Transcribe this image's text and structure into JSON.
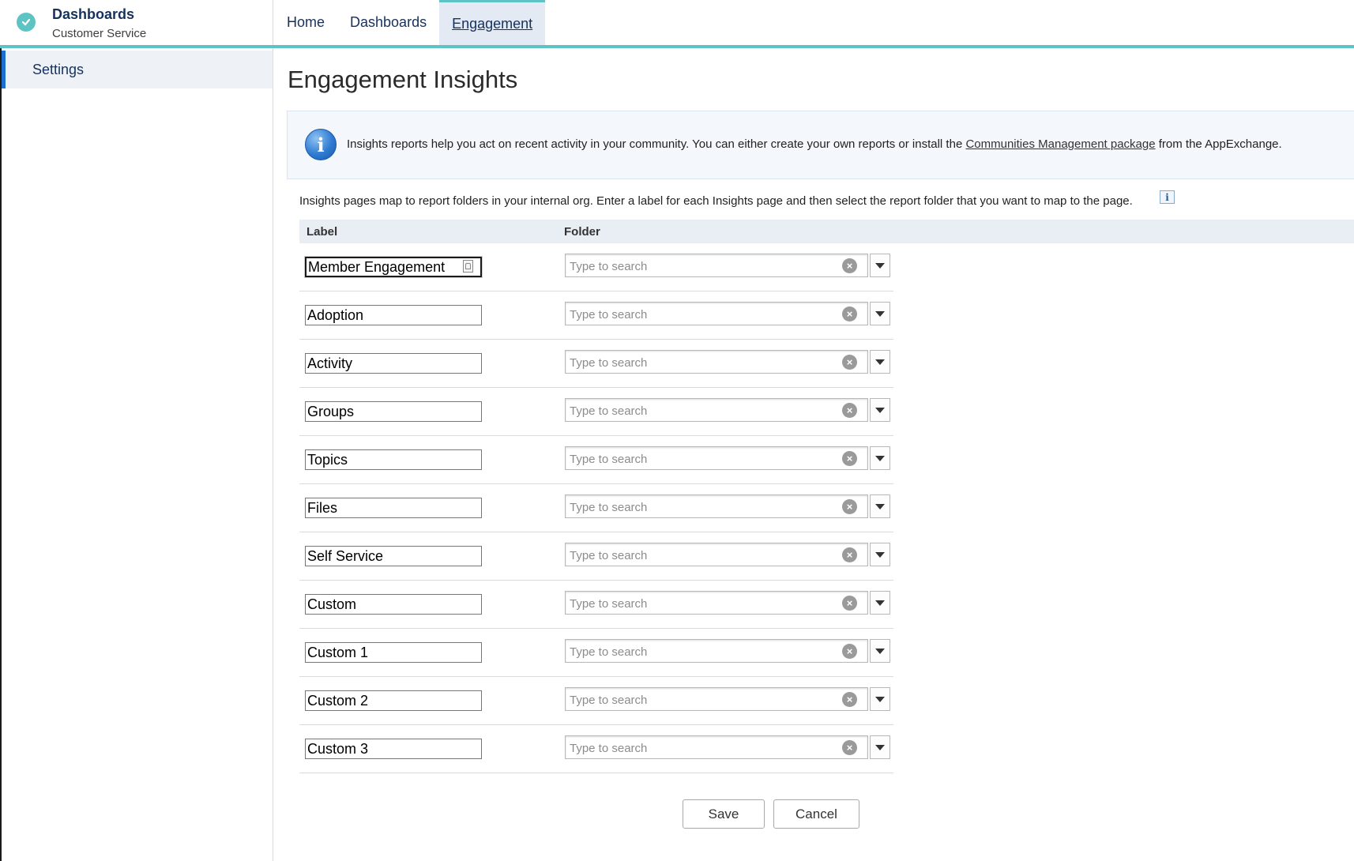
{
  "header": {
    "app_title": "Dashboards",
    "app_subtitle": "Customer Service",
    "nav": [
      {
        "label": "Home"
      },
      {
        "label": "Dashboards"
      },
      {
        "label": "Engagement"
      }
    ]
  },
  "sidebar": {
    "items": [
      {
        "label": "Settings"
      }
    ]
  },
  "main": {
    "title": "Engagement Insights",
    "info": {
      "text_before": "Insights reports help you act on recent activity in your community. You can either create your own reports or install the ",
      "link": "Communities Management package",
      "text_after": " from the AppExchange."
    },
    "intro": "Insights pages map to report folders in your internal org. Enter a label for each Insights page and then select the report folder that you want to map to the page.",
    "columns": {
      "label": "Label",
      "folder": "Folder"
    },
    "search_placeholder": "Type to search",
    "rows": [
      {
        "label": "Member Engagement"
      },
      {
        "label": "Adoption"
      },
      {
        "label": "Activity"
      },
      {
        "label": "Groups"
      },
      {
        "label": "Topics"
      },
      {
        "label": "Files"
      },
      {
        "label": "Self Service"
      },
      {
        "label": "Custom"
      },
      {
        "label": "Custom 1"
      },
      {
        "label": "Custom 2"
      },
      {
        "label": "Custom 3"
      }
    ],
    "save_label": "Save",
    "cancel_label": "Cancel"
  }
}
